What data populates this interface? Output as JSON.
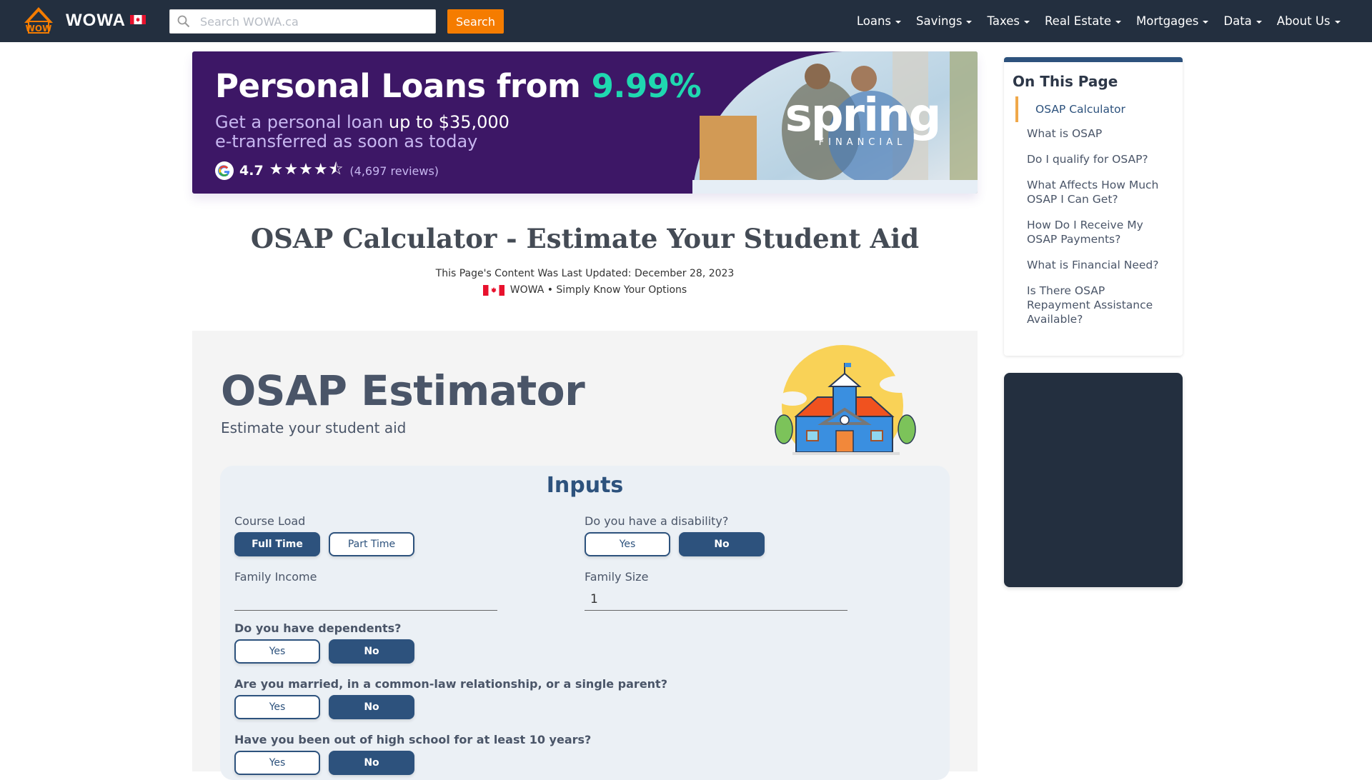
{
  "nav": {
    "brand": "WOWA",
    "search_placeholder": "Search WOWA.ca",
    "search_value": "",
    "search_button": "Search",
    "menu": [
      {
        "label": "Loans"
      },
      {
        "label": "Savings"
      },
      {
        "label": "Taxes"
      },
      {
        "label": "Real Estate"
      },
      {
        "label": "Mortgages"
      },
      {
        "label": "Data"
      },
      {
        "label": "About Us"
      }
    ]
  },
  "banner": {
    "headline": "Personal Loans from ",
    "rate": "9.99%",
    "sub_line1_a": "Get a personal loan ",
    "sub_line1_b": "up to $35,000",
    "sub_line2": "e-transferred as soon as today",
    "rating_score": "4.7",
    "rating_value": 4.7,
    "rating_max": 5,
    "reviews": "(4,697 reviews)",
    "advertiser_word": "spring",
    "advertiser_sub": "FINANCIAL",
    "colors": {
      "background": "#3d1766",
      "accent": "#1fd8b0"
    }
  },
  "page": {
    "title": "OSAP Calculator - Estimate Your Student Aid",
    "updated": "This Page's Content Was Last Updated: December 28, 2023",
    "tagline": "WOWA • Simply Know Your Options"
  },
  "estimator": {
    "title": "OSAP Estimator",
    "subtitle": "Estimate your student aid",
    "inputs_title": "Inputs",
    "course_load": {
      "label": "Course Load",
      "options": [
        "Full Time",
        "Part Time"
      ],
      "selected": "Full Time"
    },
    "disability": {
      "label": "Do you have a disability?",
      "options": [
        "Yes",
        "No"
      ],
      "selected": "No"
    },
    "family_income": {
      "label": "Family Income",
      "value": ""
    },
    "family_size": {
      "label": "Family Size",
      "value": "1"
    },
    "dependents": {
      "label": "Do you have dependents?",
      "options": [
        "Yes",
        "No"
      ],
      "selected": "No"
    },
    "married": {
      "label": "Are you married, in a common-law relationship, or a single parent?",
      "options": [
        "Yes",
        "No"
      ],
      "selected": "No"
    },
    "out_of_school": {
      "label": "Have you been out of high school for at least 10 years?",
      "options": [
        "Yes",
        "No"
      ],
      "selected": "No"
    }
  },
  "toc": {
    "title": "On This Page",
    "items": [
      {
        "label": "OSAP Calculator",
        "active": true
      },
      {
        "label": "What is OSAP"
      },
      {
        "label": "Do I qualify for OSAP?"
      },
      {
        "label": "What Affects How Much OSAP I Can Get?"
      },
      {
        "label": "How Do I Receive My OSAP Payments?"
      },
      {
        "label": "What is Financial Need?"
      },
      {
        "label": "Is There OSAP Repayment Assistance Available?"
      }
    ]
  },
  "colors": {
    "nav_bg": "#232f3f",
    "search_button": "#f57c00",
    "primary": "#2d527d",
    "toc_active_bar": "#f0a84a"
  }
}
